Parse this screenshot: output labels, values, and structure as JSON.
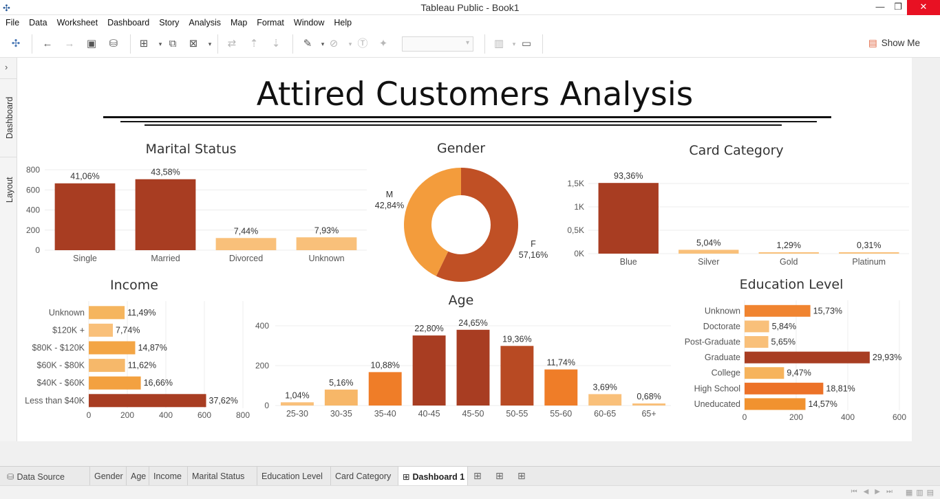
{
  "window": {
    "title": "Tableau Public - Book1",
    "minimize": "—",
    "restore": "❐",
    "close": "✕"
  },
  "menu": [
    "File",
    "Data",
    "Worksheet",
    "Dashboard",
    "Story",
    "Analysis",
    "Map",
    "Format",
    "Window",
    "Help"
  ],
  "toolbar": {
    "show_me": "Show Me"
  },
  "left_tabs": {
    "dashboard": "Dashboard",
    "layout": "Layout"
  },
  "dashboard": {
    "title": "Attired Customers Analysis"
  },
  "charts": {
    "marital": {
      "title": "Marital Status"
    },
    "gender": {
      "title": "Gender"
    },
    "card": {
      "title": "Card Category"
    },
    "income": {
      "title": "Income"
    },
    "age": {
      "title": "Age"
    },
    "education": {
      "title": "Education Level"
    }
  },
  "chart_data": [
    {
      "id": "marital",
      "type": "bar",
      "title": "Marital Status",
      "categories": [
        "Single",
        "Married",
        "Divorced",
        "Unknown"
      ],
      "values": [
        665,
        706,
        121,
        128
      ],
      "labels": [
        "41,06%",
        "43,58%",
        "7,44%",
        "7,93%"
      ],
      "colors": [
        "#a83d22",
        "#a83d22",
        "#f9c07a",
        "#f9c07a"
      ],
      "yticks": [
        "0",
        "200",
        "400",
        "600",
        "800"
      ],
      "ylim": [
        0,
        800
      ]
    },
    {
      "id": "gender",
      "type": "pie",
      "title": "Gender",
      "categories": [
        "F",
        "M"
      ],
      "values": [
        57.16,
        42.84
      ],
      "labels": [
        "57,16%",
        "42,84%"
      ],
      "colors": [
        "#c05025",
        "#f39c3c"
      ]
    },
    {
      "id": "card",
      "type": "bar",
      "title": "Card Category",
      "categories": [
        "Blue",
        "Silver",
        "Gold",
        "Platinum"
      ],
      "values": [
        1512,
        82,
        21,
        5
      ],
      "labels": [
        "93,36%",
        "5,04%",
        "1,29%",
        "0,31%"
      ],
      "colors": [
        "#a83d22",
        "#f9c07a",
        "#f9c07a",
        "#f9c07a"
      ],
      "yticks": [
        "0K",
        "0,5K",
        "1K",
        "1,5K"
      ],
      "ylim": [
        0,
        1500
      ]
    },
    {
      "id": "income",
      "type": "bar",
      "orientation": "horizontal",
      "title": "Income",
      "categories": [
        "Unknown",
        "$120K +",
        "$80K - $120K",
        "$60K - $80K",
        "$40K - $60K",
        "Less than $40K"
      ],
      "values": [
        186,
        125,
        241,
        188,
        270,
        609
      ],
      "labels": [
        "11,49%",
        "7,74%",
        "14,87%",
        "11,62%",
        "16,66%",
        "37,62%"
      ],
      "colors": [
        "#f5b55e",
        "#f9c07a",
        "#f3a545",
        "#f6b86a",
        "#f3a140",
        "#a83d22"
      ],
      "xticks": [
        "0",
        "200",
        "400",
        "600",
        "800"
      ],
      "xlim": [
        0,
        800
      ]
    },
    {
      "id": "age",
      "type": "bar",
      "title": "Age",
      "categories": [
        "25-30",
        "30-35",
        "35-40",
        "40-45",
        "45-50",
        "50-55",
        "55-60",
        "60-65",
        "65+"
      ],
      "values": [
        17,
        84,
        176,
        369,
        399,
        314,
        190,
        60,
        11
      ],
      "labels": [
        "1,04%",
        "5,16%",
        "10,88%",
        "22,80%",
        "24,65%",
        "19,36%",
        "11,74%",
        "3,69%",
        "0,68%"
      ],
      "colors": [
        "#f9c07a",
        "#f7b768",
        "#ef7d28",
        "#a83d22",
        "#a83d22",
        "#b84a23",
        "#ef7d28",
        "#f9c07a",
        "#f9c07a"
      ],
      "yticks": [
        "0",
        "200",
        "400"
      ],
      "ylim": [
        0,
        420
      ]
    },
    {
      "id": "education",
      "type": "bar",
      "orientation": "horizontal",
      "title": "Education Level",
      "categories": [
        "Unknown",
        "Doctorate",
        "Post-Graduate",
        "Graduate",
        "College",
        "High School",
        "Uneducated"
      ],
      "values": [
        255,
        95,
        92,
        485,
        153,
        305,
        236
      ],
      "labels": [
        "15,73%",
        "5,84%",
        "5,65%",
        "29,93%",
        "9,47%",
        "18,81%",
        "14,57%"
      ],
      "colors": [
        "#f08430",
        "#f9c07a",
        "#f9c07a",
        "#a83d22",
        "#f6b35c",
        "#ec7228",
        "#f1922f"
      ],
      "xticks": [
        "0",
        "200",
        "400",
        "600"
      ],
      "xlim": [
        0,
        600
      ]
    }
  ],
  "sheet_tabs": [
    "Data Source",
    "Gender",
    "Age",
    "Income",
    "Marital Status",
    "Education Level",
    "Card Category",
    "Dashboard 1"
  ]
}
